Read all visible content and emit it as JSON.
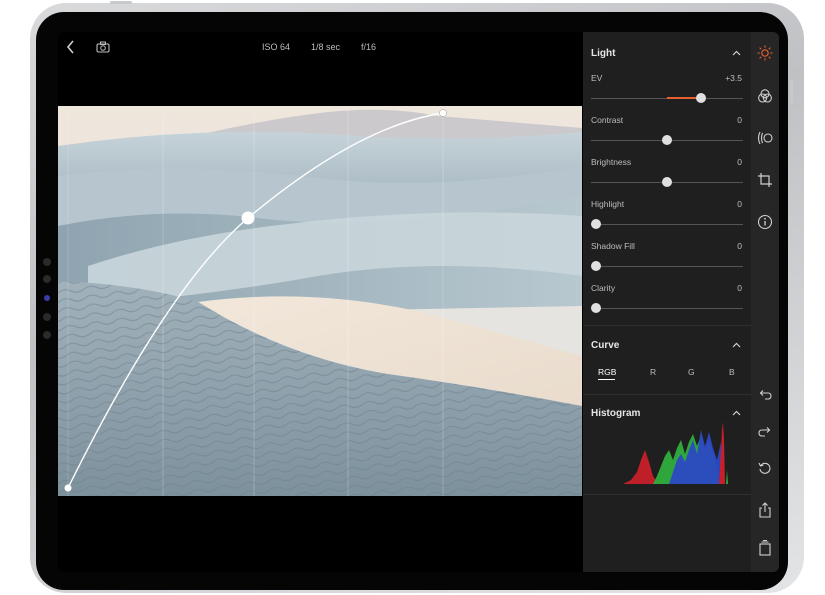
{
  "exif": {
    "iso": "ISO 64",
    "shutter": "1/8 sec",
    "aperture": "f/16"
  },
  "light": {
    "title": "Light",
    "sliders": [
      {
        "label": "EV",
        "value": "+3.5",
        "position": 0.72
      },
      {
        "label": "Contrast",
        "value": "0",
        "position": 0.5
      },
      {
        "label": "Brightness",
        "value": "0",
        "position": 0.5
      },
      {
        "label": "Highlight",
        "value": "0",
        "position": 0.0
      },
      {
        "label": "Shadow Fill",
        "value": "0",
        "position": 0.0
      },
      {
        "label": "Clarity",
        "value": "0",
        "position": 0.0
      }
    ]
  },
  "curve": {
    "title": "Curve",
    "tabs": [
      "RGB",
      "R",
      "G",
      "B"
    ],
    "active_tab": "RGB"
  },
  "histogram": {
    "title": "Histogram"
  },
  "colors": {
    "accent": "#e5602e",
    "panel": "#1f1f1f",
    "red": "#c8202a",
    "green": "#2fae3e",
    "blue": "#2c49c4"
  },
  "icons": [
    "back-chevron-icon",
    "camera-icon",
    "sun-icon",
    "color-icon",
    "vignette-icon",
    "crop-icon",
    "info-icon",
    "undo-icon",
    "redo-icon",
    "reset-icon",
    "share-icon",
    "layers-icon"
  ]
}
